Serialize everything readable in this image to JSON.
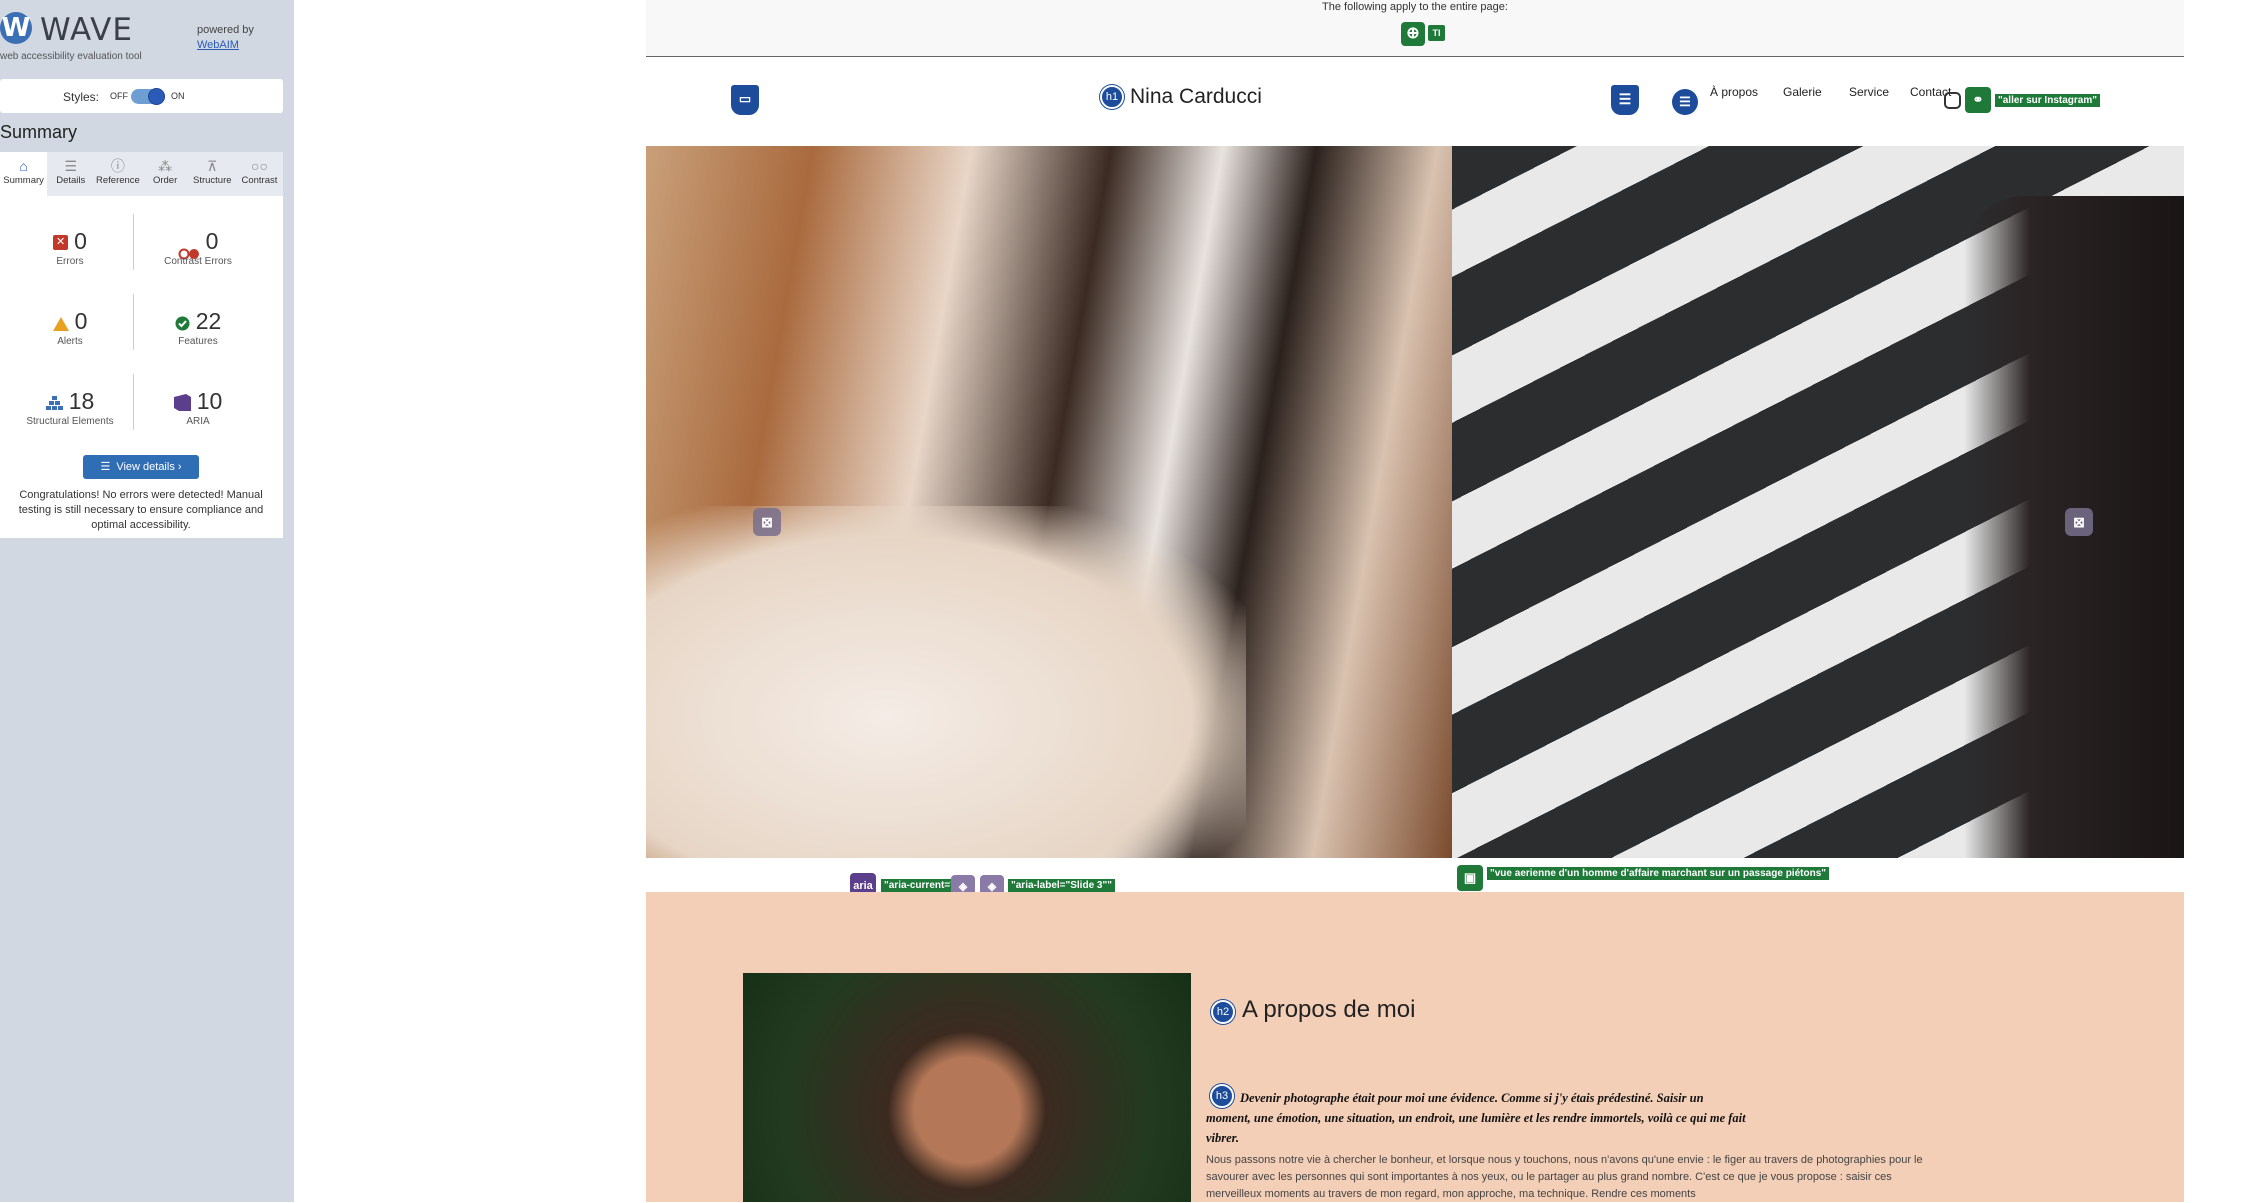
{
  "wave": {
    "logo_letter": "W",
    "title": "WAVE",
    "subtitle": "web accessibility evaluation tool",
    "powered_by": "powered by",
    "webaim": "WebAIM",
    "styles_label": "Styles:",
    "styles_off": "OFF",
    "styles_on": "ON",
    "summary_heading": "Summary",
    "tabs": [
      {
        "label": "Summary",
        "icon": "home-icon"
      },
      {
        "label": "Details",
        "icon": "list-icon"
      },
      {
        "label": "Reference",
        "icon": "info-icon"
      },
      {
        "label": "Order",
        "icon": "order-icon"
      },
      {
        "label": "Structure",
        "icon": "structure-icon"
      },
      {
        "label": "Contrast",
        "icon": "contrast-icon"
      }
    ],
    "stats": {
      "errors": {
        "value": "0",
        "label": "Errors"
      },
      "contrast_errors": {
        "value": "0",
        "label": "Contrast Errors"
      },
      "alerts": {
        "value": "0",
        "label": "Alerts"
      },
      "features": {
        "value": "22",
        "label": "Features"
      },
      "structural": {
        "value": "18",
        "label": "Structural Elements"
      },
      "aria": {
        "value": "10",
        "label": "ARIA"
      }
    },
    "view_details": "View details ›",
    "congrats": "Congratulations! No errors were detected! Manual testing is still necessary to ensure compliance and optimal accessibility."
  },
  "page": {
    "top_note": "The following apply to the entire page:",
    "site_title": "Nina Carducci",
    "nav": [
      "À propos",
      "Galerie",
      "Service",
      "Contact"
    ],
    "instagram_tag": "\"aller sur Instagram\"",
    "carousel_aria_current": "\"aria-current=\"tru",
    "carousel_aria_label": "\"aria-label=\"Slide 3\"\"",
    "slide_alt": "\"vue aerienne d'un homme d'affaire marchant sur un passage piétons\"",
    "about": {
      "h2": "A propos de moi",
      "h3": "Devenir photographe était pour moi une évidence. Comme si j'y étais prédestiné. Saisir un moment, une émotion, une situation, un endroit, une lumière et les rendre immortels, voilà ce qui me fait vibrer.",
      "p": "Nous passons notre vie à chercher le bonheur, et lorsque nous y touchons, nous n'avons qu'une envie : le figer au travers de photographies pour le savourer avec les personnes qui sont importantes à nos yeux, ou le partager au plus grand nombre. C'est ce que je vous propose : saisir ces merveilleux moments au travers de mon regard, mon approche, ma technique. Rendre ces moments"
    },
    "badges": {
      "h1": "h1",
      "h2": "h2",
      "h3": "h3",
      "aria": "aria"
    },
    "colors": {
      "wave_blue": "#2f6db5",
      "feature_green": "#1f7a3a",
      "aria_purple": "#5b3f8c",
      "about_bg": "#f4cfb7"
    }
  }
}
